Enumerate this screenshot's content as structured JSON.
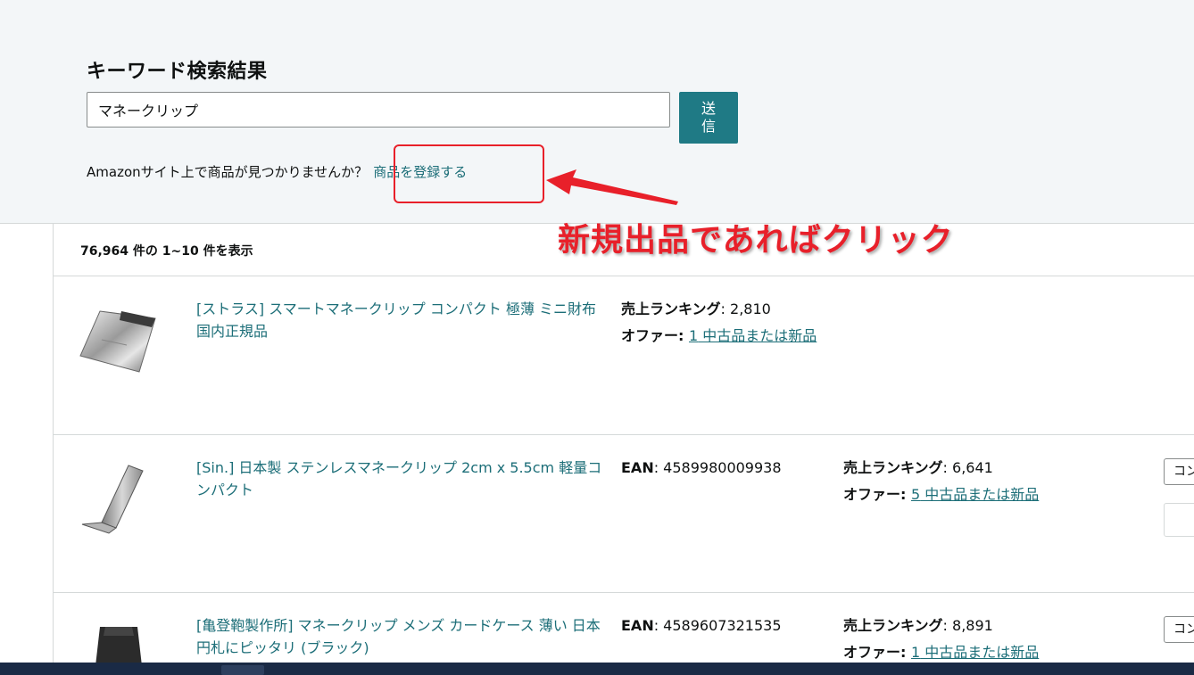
{
  "search": {
    "title": "キーワード検索結果",
    "query": "マネークリップ",
    "submit_label": "送信",
    "not_found_text": "Amazonサイト上で商品が見つかりませんか？",
    "register_link": "商品を登録する"
  },
  "annotation": {
    "text": "新規出品であればクリック",
    "color": "#e8202a"
  },
  "results": {
    "count_text": "76,964 件の 1~10 件を表示",
    "items": [
      {
        "title": "[ストラス] スマートマネークリップ コンパクト 極薄 ミニ財布 国内正規品",
        "ean_label": "",
        "ean_value": "",
        "rank_label": "売上ランキング",
        "rank_value": ": 2,810",
        "offer_label": "オファー: ",
        "offer_count": "1",
        "offer_text": " 中古品または新品",
        "button_label": "",
        "thumb_icon": "money-clip-silver-icon"
      },
      {
        "title": "[Sin.] 日本製 ステンレスマネークリップ 2cm x 5.5cm 軽量コンパクト",
        "ean_label": "EAN",
        "ean_value": ": 4589980009938",
        "rank_label": "売上ランキング",
        "rank_value": ": 6,641",
        "offer_label": "オファー: ",
        "offer_count": "5",
        "offer_text": " 中古品または新品",
        "button_label": "コン",
        "thumb_icon": "money-clip-steel-icon"
      },
      {
        "title": "[亀登鞄製作所] マネークリップ メンズ カードケース 薄い 日本円札にピッタリ (ブラック)",
        "ean_label": "EAN",
        "ean_value": ": 4589607321535",
        "rank_label": "売上ランキング",
        "rank_value": ": 8,891",
        "offer_label": "オファー: ",
        "offer_count": "1",
        "offer_text": " 中古品または新品",
        "button_label": "コン",
        "thumb_icon": "money-clip-black-icon"
      }
    ]
  },
  "colors": {
    "accent": "#1f7a85",
    "link": "#1c6e78",
    "panel": "#f3f6f8"
  }
}
